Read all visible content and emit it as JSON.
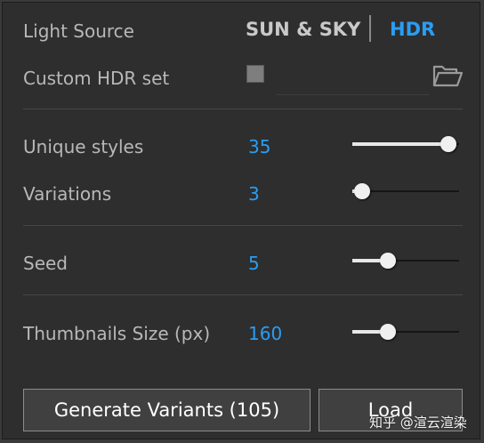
{
  "colors": {
    "accent": "#2a9df4",
    "label": "#b8b8b8",
    "inactive_tab": "#c9c9c9",
    "panel_bg": "#2e2e2e"
  },
  "light_source": {
    "label": "Light Source",
    "tabs": [
      {
        "label": "SUN & SKY",
        "active": false
      },
      {
        "label": "HDR",
        "active": true
      }
    ]
  },
  "custom_hdr": {
    "label": "Custom HDR set",
    "checked": false,
    "path_value": "",
    "folder_icon": "folder-open-icon"
  },
  "settings": {
    "unique_styles": {
      "label": "Unique styles",
      "value": "35",
      "slider_fraction": 0.9
    },
    "variations": {
      "label": "Variations",
      "value": "3",
      "slider_fraction": 0.09
    },
    "seed": {
      "label": "Seed",
      "value": "5",
      "slider_fraction": 0.33
    },
    "thumbnails_size": {
      "label": "Thumbnails Size (px)",
      "value": "160",
      "slider_fraction": 0.33
    }
  },
  "buttons": {
    "generate_label": "Generate Variants (105)",
    "load_label": "Load"
  },
  "watermark": "知乎 @渲云渲染"
}
